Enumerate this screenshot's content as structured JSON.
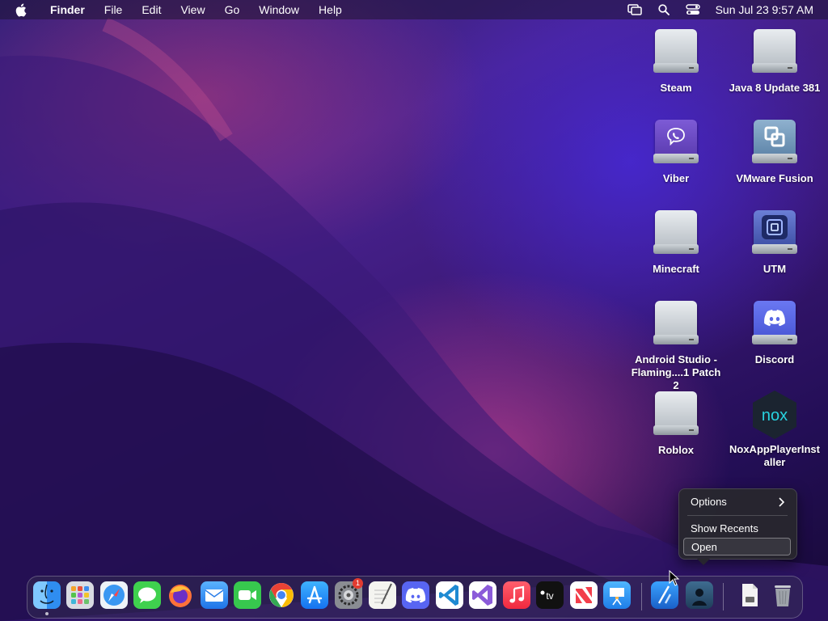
{
  "menubar": {
    "app_name": "Finder",
    "menus": [
      "File",
      "Edit",
      "View",
      "Go",
      "Window",
      "Help"
    ],
    "status_icons": [
      "screen-mirroring-icon",
      "spotlight-search-icon",
      "control-center-icon"
    ],
    "clock": "Sun Jul 23  9:57 AM"
  },
  "desktop": {
    "items": [
      {
        "label": "Steam",
        "icon": "drive-icon"
      },
      {
        "label": "Java 8 Update 381",
        "icon": "drive-icon"
      },
      {
        "label": "Viber",
        "icon": "viber-drive-icon"
      },
      {
        "label": "VMware Fusion",
        "icon": "vmware-drive-icon"
      },
      {
        "label": "Minecraft",
        "icon": "drive-icon"
      },
      {
        "label": "UTM",
        "icon": "utm-drive-icon"
      },
      {
        "label": "Android Studio -",
        "label2": "Flaming....1 Patch 2",
        "icon": "drive-icon"
      },
      {
        "label": "Discord",
        "icon": "discord-drive-icon"
      },
      {
        "label": "Roblox",
        "icon": "drive-icon"
      },
      {
        "label": "NoxAppPlayerInst",
        "label2": "aller",
        "icon": "nox-icon"
      }
    ]
  },
  "context_menu": {
    "items": [
      "Options",
      "Show Recents",
      "Open"
    ]
  },
  "dock": {
    "apps": [
      "Finder",
      "Launchpad",
      "Safari",
      "Messages",
      "Firefox",
      "Mail",
      "FaceTime",
      "Google Chrome",
      "App Store",
      "System Settings",
      "TextEdit",
      "Discord",
      "Visual Studio Code",
      "Visual Studio",
      "Music",
      "TV",
      "News",
      "Keynote",
      "Xcode",
      "Downloads",
      "Documents",
      "Trash"
    ],
    "settings_badge": "1"
  },
  "colors": {
    "accent": "#2f7bf6"
  }
}
